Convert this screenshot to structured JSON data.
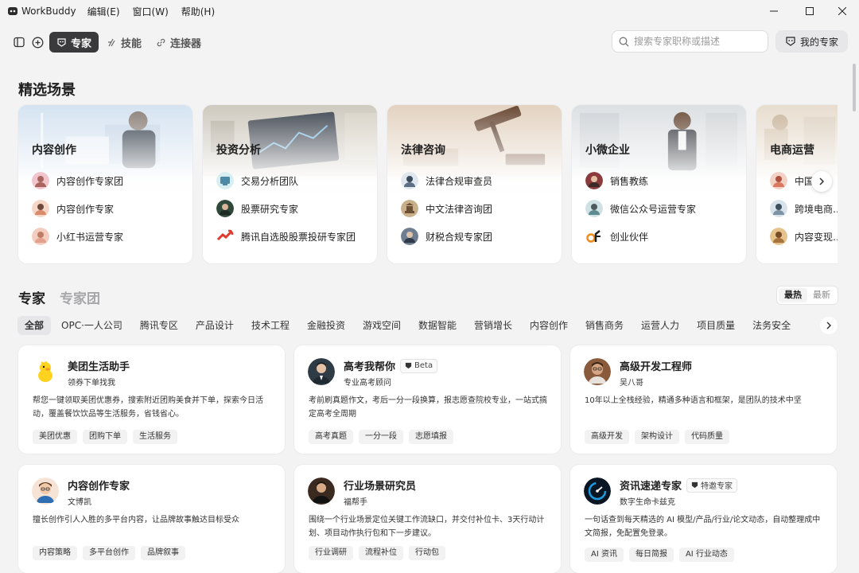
{
  "titlebar": {
    "app_name": "WorkBuddy",
    "menus": [
      "编辑(E)",
      "窗口(W)",
      "帮助(H)"
    ]
  },
  "toolbar": {
    "tabs": [
      {
        "label": "专家",
        "active": true
      },
      {
        "label": "技能",
        "active": false
      },
      {
        "label": "连接器",
        "active": false
      }
    ],
    "search_placeholder": "搜索专家职称或描述",
    "my_experts_label": "我的专家"
  },
  "featured": {
    "title": "精选场景",
    "scenes": [
      {
        "title": "内容创作",
        "items": [
          "内容创作专家团",
          "内容创作专家",
          "小红书运营专家"
        ]
      },
      {
        "title": "投资分析",
        "items": [
          "交易分析团队",
          "股票研究专家",
          "腾讯自选股股票投研专家团"
        ]
      },
      {
        "title": "法律咨询",
        "items": [
          "法律合规审查员",
          "中文法律咨询团",
          "财税合规专家团"
        ]
      },
      {
        "title": "小微企业",
        "items": [
          "销售教练",
          "微信公众号运营专家",
          "创业伙伴"
        ]
      },
      {
        "title": "电商运营",
        "items": [
          "中国…",
          "跨境电商…",
          "内容变现…"
        ]
      }
    ]
  },
  "experts": {
    "tabs": [
      "专家",
      "专家团"
    ],
    "sort": [
      "最热",
      "最新"
    ],
    "categories": [
      "全部",
      "OPC·一人公司",
      "腾讯专区",
      "产品设计",
      "技术工程",
      "金融投资",
      "游戏空间",
      "数据智能",
      "营销增长",
      "内容创作",
      "销售商务",
      "运营人力",
      "项目质量",
      "法务安全"
    ],
    "cards": [
      {
        "name": "美团生活助手",
        "subtitle": "领券下单找我",
        "badge": "",
        "description": "帮您一键领取美团优惠券，搜索附近团购美食并下单，探索今日活动，覆盖餐饮饮品等生活服务，省钱省心。",
        "tags": [
          "美团优惠",
          "团购下单",
          "生活服务"
        ]
      },
      {
        "name": "高考我帮你",
        "subtitle": "专业高考顾问",
        "badge": "Beta",
        "description": "考前刷真题作文，考后一分一段换算，报志愿查院校专业，一站式搞定高考全周期",
        "tags": [
          "高考真题",
          "一分一段",
          "志愿填报"
        ]
      },
      {
        "name": "高级开发工程师",
        "subtitle": "吴八哥",
        "badge": "",
        "description": "10年以上全栈经验，精通多种语言和框架，是团队的技术中坚",
        "tags": [
          "高级开发",
          "架构设计",
          "代码质量"
        ]
      },
      {
        "name": "内容创作专家",
        "subtitle": "文博凯",
        "badge": "",
        "description": "擅长创作引人入胜的多平台内容，让品牌故事触达目标受众",
        "tags": [
          "内容策略",
          "多平台创作",
          "品牌叙事"
        ]
      },
      {
        "name": "行业场景研究员",
        "subtitle": "福帮手",
        "badge": "",
        "description": "围绕一个行业场景定位关键工作流缺口，并交付补位卡、3天行动计划、项目动作执行包和下一步建议。",
        "tags": [
          "行业调研",
          "流程补位",
          "行动包"
        ]
      },
      {
        "name": "资讯速递专家",
        "subtitle": "数字生命卡兹克",
        "badge": "特邀专家",
        "description": "一句话查到每天精选的 AI 模型/产品/行业/论文动态，自动整理成中文简报，免配置免登录。",
        "tags": [
          "AI 资讯",
          "每日简报",
          "AI 行业动态"
        ]
      }
    ]
  }
}
